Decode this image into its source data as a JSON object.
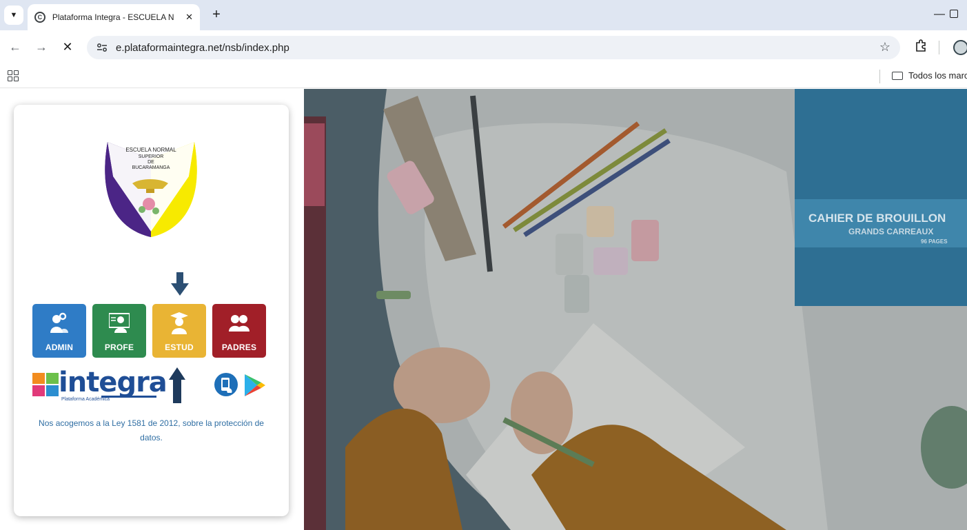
{
  "browser": {
    "tab_title": "Plataforma Integra - ESCUELA N",
    "url": "e.plataformaintegra.net/nsb/index.php",
    "bookmark_folder": "Todos los marc"
  },
  "crest": {
    "text_line1": "ESCUELA NORMAL",
    "text_line2": "SUPERIOR",
    "text_line3": "DE",
    "text_line4": "BUCARAMANGA"
  },
  "roles": [
    {
      "label": "ADMIN",
      "color": "#2f7cc6",
      "icon": "users-gear-icon"
    },
    {
      "label": "PROFE",
      "color": "#2e8b4f",
      "icon": "teacher-board-icon"
    },
    {
      "label": "ESTUD",
      "color": "#e9b434",
      "icon": "graduate-icon"
    },
    {
      "label": "PADRES",
      "color": "#a11f28",
      "icon": "parents-group-icon"
    }
  ],
  "brand": {
    "name": "integra",
    "tagline": "Plataforma Académica"
  },
  "privacy_notice": "Nos acogemos a la Ley 1581 de 2012, sobre la protección de datos.",
  "hero": {
    "notebook_title": "CAHIER DE BROUILLON",
    "notebook_subtitle": "GRANDS CARREAUX",
    "notebook_pages": "96 PAGES"
  }
}
